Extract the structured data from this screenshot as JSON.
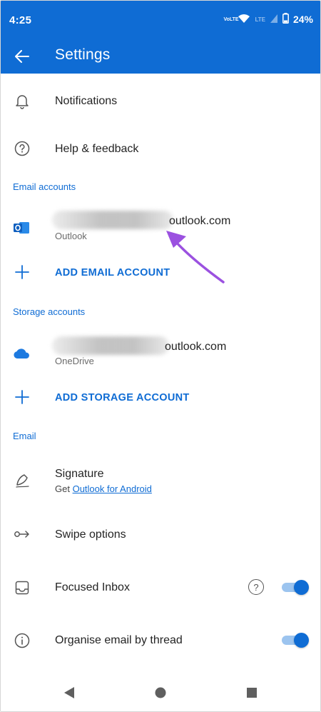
{
  "status_bar": {
    "time": "4:25",
    "volte_label": "VoLTE",
    "lte_label": "LTE",
    "battery": "24%"
  },
  "app_bar": {
    "title": "Settings"
  },
  "general": {
    "notifications": "Notifications",
    "help_feedback": "Help & feedback"
  },
  "email_accounts": {
    "header": "Email accounts",
    "account_domain": "outlook.com",
    "account_type": "Outlook",
    "add_label": "ADD EMAIL ACCOUNT"
  },
  "storage_accounts": {
    "header": "Storage accounts",
    "account_domain": "outlook.com",
    "account_type": "OneDrive",
    "add_label": "ADD STORAGE ACCOUNT"
  },
  "email_section": {
    "header": "Email",
    "signature": "Signature",
    "signature_prefix": "Get ",
    "signature_link": "Outlook for Android",
    "swipe_options": "Swipe options",
    "focused_inbox": "Focused Inbox",
    "focused_inbox_help": "?",
    "organise_by_thread": "Organise email by thread"
  },
  "colors": {
    "brand_blue": "#0f6cd4",
    "annotation_arrow": "#9b51e0"
  },
  "icons": {
    "back": "arrow-left-icon",
    "notifications": "bell-icon",
    "help": "question-circle-icon",
    "outlook": "outlook-logo-icon",
    "onedrive": "onedrive-cloud-icon",
    "add": "plus-icon",
    "signature": "pen-icon",
    "swipe": "swipe-arrow-icon",
    "focused_inbox": "inbox-tray-icon",
    "organise_thread": "info-circle-icon"
  }
}
